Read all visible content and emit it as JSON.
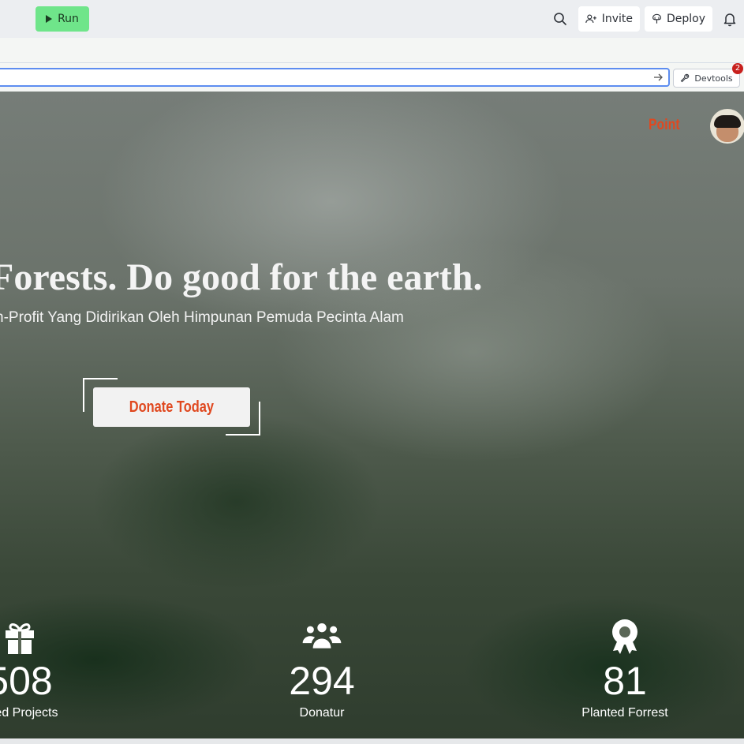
{
  "toolbar": {
    "run_label": "Run",
    "invite_label": "Invite",
    "deploy_label": "Deploy"
  },
  "browser": {
    "url_value": "",
    "devtools_label": "Devtools",
    "devtools_badge": "2"
  },
  "site": {
    "brand": "Point",
    "headline": "Forests. Do good for the earth.",
    "subheadline": "n-Profit Yang Didirikan Oleh Himpunan Pemuda Pecinta Alam",
    "cta_label": "Donate Today",
    "stats": [
      {
        "icon": "gift-icon",
        "value": "508",
        "label": "leted Projects"
      },
      {
        "icon": "users-icon",
        "value": "294",
        "label": "Donatur"
      },
      {
        "icon": "award-icon",
        "value": "81",
        "label": "Planted Forrest"
      }
    ]
  },
  "colors": {
    "run_green": "#6fe58a",
    "brand_orange": "#e0481f",
    "url_focus_blue": "#5d8df0",
    "badge_red": "#c8201d"
  }
}
